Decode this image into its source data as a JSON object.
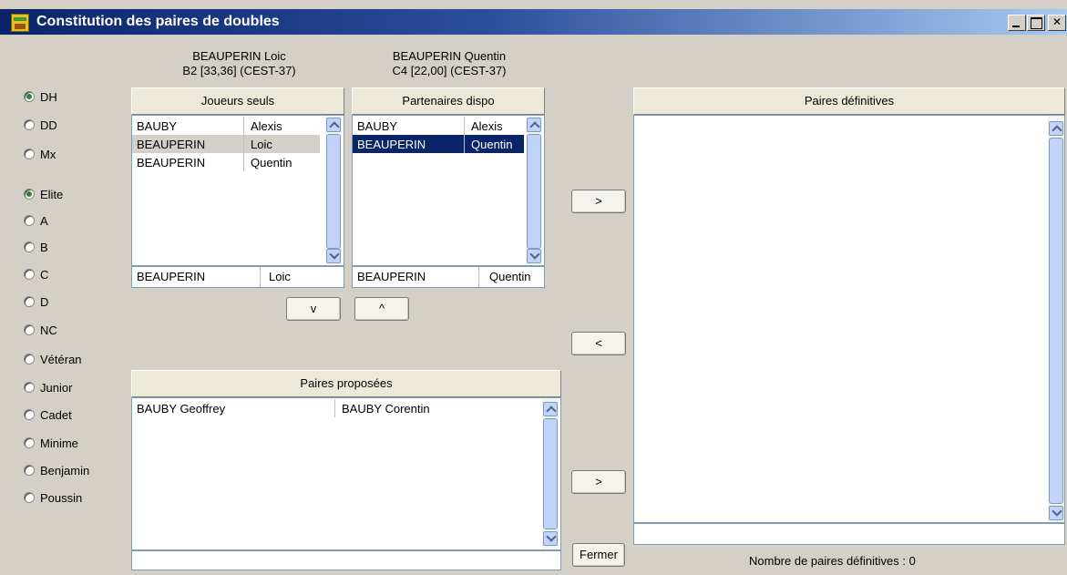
{
  "window": {
    "title": "Constitution des paires de doubles",
    "app_icon": "app-logo-icon"
  },
  "radios": [
    {
      "label": "DH",
      "checked": true
    },
    {
      "label": "DD",
      "checked": false
    },
    {
      "label": "Mx",
      "checked": false
    },
    {
      "label": "Elite",
      "checked": true
    },
    {
      "label": "A",
      "checked": false
    },
    {
      "label": "B",
      "checked": false
    },
    {
      "label": "C",
      "checked": false
    },
    {
      "label": "D",
      "checked": false
    },
    {
      "label": "NC",
      "checked": false
    },
    {
      "label": "Vétéran",
      "checked": false
    },
    {
      "label": "Junior",
      "checked": false
    },
    {
      "label": "Cadet",
      "checked": false
    },
    {
      "label": "Minime",
      "checked": false
    },
    {
      "label": "Benjamin",
      "checked": false
    },
    {
      "label": "Poussin",
      "checked": false
    }
  ],
  "player1": {
    "name": "BEAUPERIN Loic",
    "detail": "B2 [33,36] (CEST-37)"
  },
  "player2": {
    "name": "BEAUPERIN Quentin",
    "detail": "C4 [22,00] (CEST-37)"
  },
  "joueurs": {
    "header": "Joueurs seuls",
    "rows": [
      {
        "last": "BAUBY",
        "first": "Alexis",
        "selected": false
      },
      {
        "last": "BEAUPERIN",
        "first": "Loic",
        "selected": true
      },
      {
        "last": "BEAUPERIN",
        "first": "Quentin",
        "selected": false
      }
    ],
    "footer": {
      "last": "BEAUPERIN",
      "first": "Loic"
    }
  },
  "partenaires": {
    "header": "Partenaires dispo",
    "rows": [
      {
        "last": "BAUBY",
        "first": "Alexis",
        "selected": false
      },
      {
        "last": "BEAUPERIN",
        "first": "Quentin",
        "selected": true
      }
    ],
    "footer": {
      "last": "BEAUPERIN",
      "first": "Quentin"
    }
  },
  "buttons": {
    "down": "v",
    "up": "^",
    "add_def_top": ">",
    "remove_def": "<",
    "add_def_bottom": ">",
    "close": "Fermer"
  },
  "proposees": {
    "header": "Paires proposées",
    "rows": [
      {
        "p1": "BAUBY Geoffrey",
        "p2": "BAUBY Corentin"
      }
    ]
  },
  "definitives": {
    "header": "Paires définitives",
    "status": "Nombre de paires définitives : 0"
  }
}
